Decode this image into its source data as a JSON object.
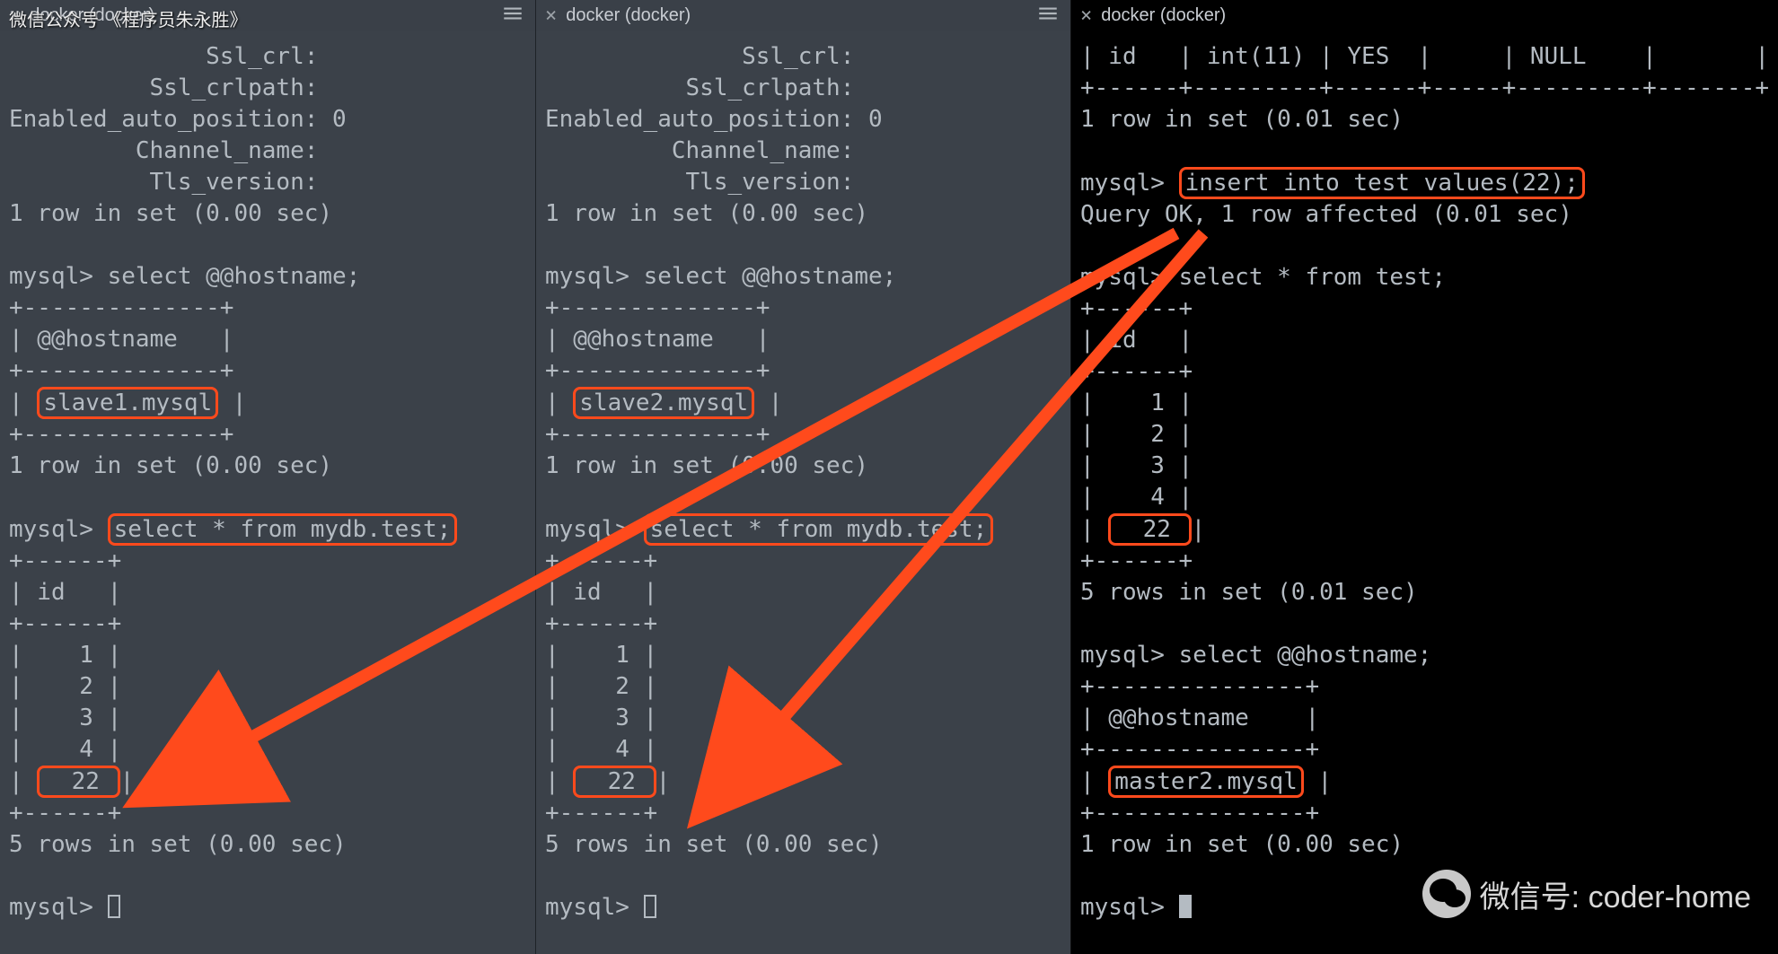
{
  "watermark_top": "微信公众号 《程序员朱永胜》",
  "watermark_bottom": "微信号: coder-home",
  "tabs": {
    "pane1_title": "docker (docker)",
    "pane2_title": "docker (docker)",
    "pane3_title": "docker (docker)"
  },
  "pane1": {
    "status_lines": [
      "              Ssl_crl:",
      "          Ssl_crlpath:",
      "Enabled_auto_position: 0",
      "         Channel_name:",
      "          Tls_version:"
    ],
    "row1": "1 row in set (0.00 sec)",
    "prompt": "mysql>",
    "select_hostname": "select @@hostname;",
    "sep_small": "+--------------+",
    "col_hostname": "| @@hostname   |",
    "hostname_value": "slave1.mysql",
    "row1b": "1 row in set (0.00 sec)",
    "select_test": "select * from mydb.test;",
    "sep_id": "+------+",
    "col_id": "| id   |",
    "ids": [
      "|    1 |",
      "|    2 |",
      "|    3 |",
      "|    4 |"
    ],
    "id_22": "22",
    "row5": "5 rows in set (0.00 sec)"
  },
  "pane2": {
    "status_lines": [
      "              Ssl_crl:",
      "          Ssl_crlpath:",
      "Enabled_auto_position: 0",
      "         Channel_name:",
      "          Tls_version:"
    ],
    "row1": "1 row in set (0.00 sec)",
    "prompt": "mysql>",
    "select_hostname": "select @@hostname;",
    "sep_small": "+--------------+",
    "col_hostname": "| @@hostname   |",
    "hostname_value": "slave2.mysql",
    "row1b": "1 row in set (0.00 sec)",
    "select_test": "select * from mydb.test;",
    "sep_id": "+------+",
    "col_id": "| id   |",
    "ids": [
      "|    1 |",
      "|    2 |",
      "|    3 |",
      "|    4 |"
    ],
    "id_22": "22",
    "row5": "5 rows in set (0.00 sec)"
  },
  "pane3": {
    "desc_row": "| id   | int(11) | YES  |     | NULL    |       |",
    "desc_sep": "+------+---------+------+-----+---------+-------+",
    "row1": "1 row in set (0.01 sec)",
    "prompt": "mysql>",
    "insert_stmt": "insert into test values(22);",
    "query_ok": "Query OK, 1 row affected (0.01 sec)",
    "select_test": "select * from test;",
    "sep_id": "+------+",
    "col_id": "| id   |",
    "ids": [
      "|    1 |",
      "|    2 |",
      "|    3 |",
      "|    4 |"
    ],
    "id_22": "22",
    "row5": "5 rows in set (0.01 sec)",
    "select_hostname": "select @@hostname;",
    "sep_host": "+---------------+",
    "col_hostname": "| @@hostname    |",
    "hostname_value": "master2.mysql",
    "row1b": "1 row in set (0.00 sec)"
  }
}
